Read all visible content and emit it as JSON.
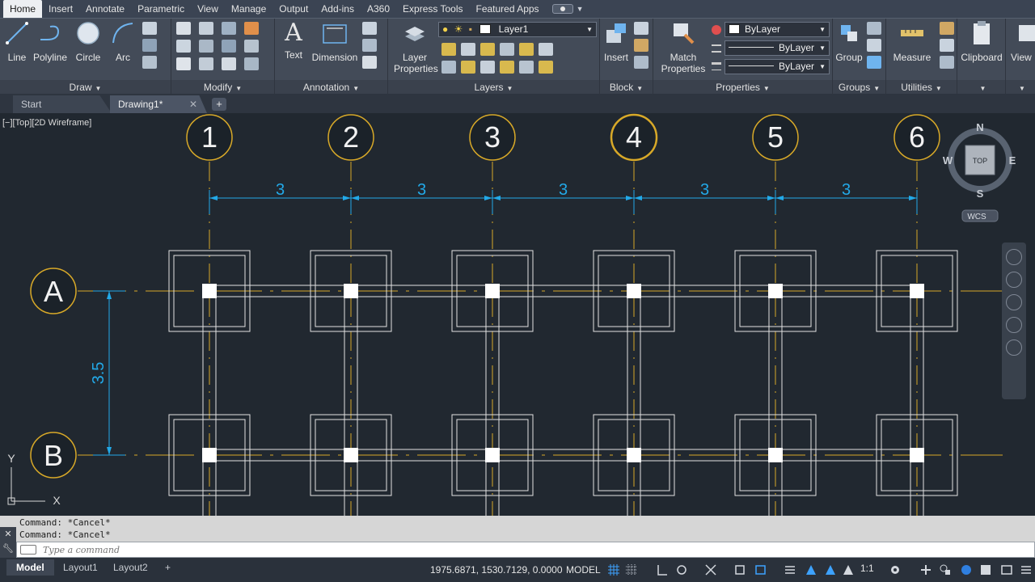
{
  "ribbon_tabs": [
    "Home",
    "Insert",
    "Annotate",
    "Parametric",
    "View",
    "Manage",
    "Output",
    "Add-ins",
    "A360",
    "Express Tools",
    "Featured Apps"
  ],
  "active_tab": "Home",
  "draw": {
    "title": "Draw",
    "line": "Line",
    "polyline": "Polyline",
    "circle": "Circle",
    "arc": "Arc"
  },
  "modify": {
    "title": "Modify"
  },
  "annotation": {
    "title": "Annotation",
    "text": "Text",
    "dimension": "Dimension"
  },
  "layers": {
    "title": "Layers",
    "properties": "Layer Properties",
    "current_layer": "Layer1"
  },
  "block": {
    "title": "Block",
    "insert": "Insert"
  },
  "properties": {
    "title": "Properties",
    "match": "Match Properties",
    "color": "ByLayer",
    "linetype": "ByLayer",
    "lineweight": "ByLayer"
  },
  "groups": {
    "title": "Groups",
    "group": "Group"
  },
  "utilities": {
    "title": "Utilities",
    "measure": "Measure"
  },
  "clipboard": {
    "title": "Clipboard",
    "label": "Clipboard"
  },
  "view_partial": "View",
  "file_tabs": {
    "start": "Start",
    "drawing": "Drawing1*",
    "close": "✕",
    "add": "+"
  },
  "viewport_label": "[−][Top][2D Wireframe]",
  "grid": {
    "columns": [
      "1",
      "2",
      "3",
      "4",
      "5",
      "6"
    ],
    "rows": [
      "A",
      "B"
    ],
    "column_spacing": [
      "3",
      "3",
      "3",
      "3",
      "3"
    ],
    "row_spacing": "3.5"
  },
  "viewcube": {
    "top": "TOP",
    "n": "N",
    "s": "S",
    "e": "E",
    "w": "W",
    "wcs": "WCS"
  },
  "ucs": {
    "x": "X",
    "y": "Y"
  },
  "command": {
    "history": [
      "Command: *Cancel*",
      "Command: *Cancel*"
    ],
    "placeholder": "Type a command"
  },
  "status": {
    "layouts": [
      "Model",
      "Layout1",
      "Layout2"
    ],
    "coordinates": "1975.6871, 1530.7129, 0.0000",
    "space": "MODEL",
    "scale": "1:1"
  },
  "colors": {
    "grid_bubble": "#d8a928",
    "dimension": "#22a9e8",
    "footing": "#e2e2e2",
    "background": "#212830"
  }
}
